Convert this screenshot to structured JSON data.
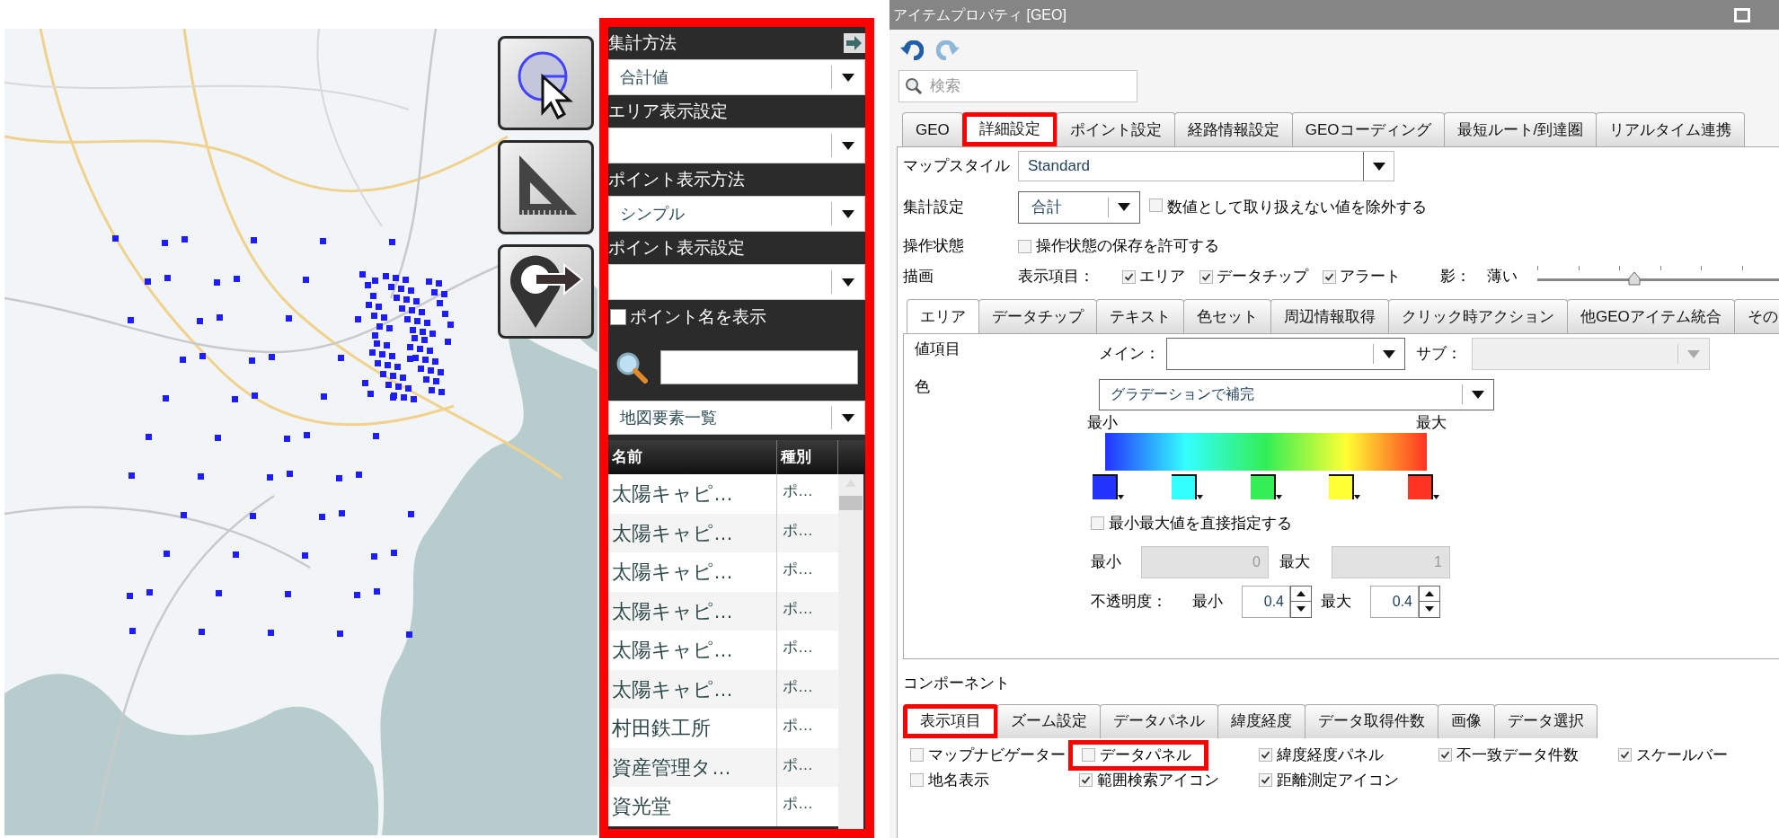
{
  "data_panel": {
    "highlighted": true,
    "fields": [
      {
        "kind": "dropdown",
        "label": "集計方法",
        "value": "合計値"
      },
      {
        "kind": "dropdown",
        "label": "エリア表示設定"
      },
      {
        "kind": "dropdown",
        "label": "ポイント表示方法",
        "value": "シンプル"
      },
      {
        "kind": "dropdown",
        "label": "ポイント表示設定"
      },
      {
        "kind": "checkbox",
        "label": "ポイント名を表示",
        "checked": false
      }
    ],
    "list_select": {
      "value": "地図要素一覧"
    },
    "table": {
      "columns": [
        "名前",
        "種別"
      ],
      "rows": [
        {
          "name": "太陽キャピ…",
          "type": "ポ…"
        },
        {
          "name": "太陽キャピ…",
          "type": "ポ…"
        },
        {
          "name": "太陽キャピ…",
          "type": "ポ…"
        },
        {
          "name": "太陽キャピ…",
          "type": "ポ…"
        },
        {
          "name": "太陽キャピ…",
          "type": "ポ…"
        },
        {
          "name": "太陽キャピ…",
          "type": "ポ…"
        },
        {
          "name": "村田鉄工所",
          "type": "ポ…"
        },
        {
          "name": "資産管理タ…",
          "type": "ポ…"
        },
        {
          "name": "資光堂",
          "type": "ポ…"
        }
      ]
    }
  },
  "window": {
    "title": "アイテムプロパティ [GEO]",
    "search": {
      "placeholder": "検索"
    },
    "tabs": [
      {
        "label": "GEO",
        "selected": false,
        "highlighted": false
      },
      {
        "label": "詳細設定",
        "selected": true,
        "highlighted": true
      },
      {
        "label": "ポイント設定",
        "selected": false,
        "highlighted": false
      },
      {
        "label": "経路情報設定",
        "selected": false,
        "highlighted": false
      },
      {
        "label": "GEOコーディング",
        "selected": false,
        "highlighted": false
      },
      {
        "label": "最短ルート/到達圏",
        "selected": false,
        "highlighted": false
      },
      {
        "label": "リアルタイム連携",
        "selected": false,
        "highlighted": false
      }
    ],
    "settings": {
      "map_style": {
        "label": "マップスタイル",
        "value": "Standard"
      },
      "aggregation": {
        "label": "集計設定",
        "value": "合計",
        "option": {
          "label": "数値として取り扱えない値を除外する",
          "checked": false
        }
      },
      "operation": {
        "label": "操作状態",
        "option": {
          "label": "操作状態の保存を許可する",
          "checked": false
        }
      },
      "drawing": {
        "label": "描画",
        "items_label": "表示項目：",
        "items": [
          {
            "label": "エリア",
            "checked": true
          },
          {
            "label": "データチップ",
            "checked": true
          },
          {
            "label": "アラート",
            "checked": true
          }
        ],
        "shadow_label": "影：",
        "shadow_value": "薄い",
        "shadow_level": {
          "level": 0.4
        }
      }
    },
    "sub_tabs": [
      {
        "label": "エリア",
        "selected": true
      },
      {
        "label": "データチップ",
        "selected": false
      },
      {
        "label": "テキスト",
        "selected": false
      },
      {
        "label": "色セット",
        "selected": false
      },
      {
        "label": "周辺情報取得",
        "selected": false
      },
      {
        "label": "クリック時アクション",
        "selected": false
      },
      {
        "label": "他GEOアイテム統合",
        "selected": false
      },
      {
        "label": "その",
        "selected": false
      }
    ],
    "area": {
      "value_item_label": "値項目",
      "main_label": "メイン：",
      "sub_label": "サブ：",
      "sub_disabled": true,
      "color_label": "色",
      "color_mode": "グラデーションで補完",
      "gradient_min": "最小",
      "gradient_max": "最大",
      "stops": [
        {
          "color": "#2233ff"
        },
        {
          "color": "#33ffff"
        },
        {
          "color": "#33ee55"
        },
        {
          "color": "#ffff33"
        },
        {
          "color": "#ff3322"
        }
      ],
      "direct": {
        "label": "最小最大値を直接指定する",
        "checked": false
      },
      "min_label": "最小",
      "min_value": "0",
      "max_label": "最大",
      "max_value": "1",
      "range_disabled": true,
      "opacity_label": "不透明度：",
      "opacity_min_label": "最小",
      "opacity_min": "0.4",
      "opacity_max_label": "最大",
      "opacity_max": "0.4"
    },
    "components": {
      "label": "コンポーネント",
      "tabs": [
        {
          "label": "表示項目",
          "selected": true,
          "highlighted": true
        },
        {
          "label": "ズーム設定",
          "selected": false,
          "highlighted": false
        },
        {
          "label": "データパネル",
          "selected": false,
          "highlighted": false
        },
        {
          "label": "緯度経度",
          "selected": false,
          "highlighted": false
        },
        {
          "label": "データ取得件数",
          "selected": false,
          "highlighted": false
        },
        {
          "label": "画像",
          "selected": false,
          "highlighted": false
        },
        {
          "label": "データ選択",
          "selected": false,
          "highlighted": false
        }
      ],
      "options": [
        {
          "label": "マップナビゲーター",
          "checked": false,
          "highlighted": false
        },
        {
          "label": "データパネル",
          "checked": false,
          "highlighted": true
        },
        {
          "label": "緯度経度パネル",
          "checked": true,
          "highlighted": false
        },
        {
          "label": "不一致データ件数",
          "checked": true,
          "highlighted": false
        },
        {
          "label": "スケールバー",
          "checked": true,
          "highlighted": false
        },
        {
          "label": "地名表示",
          "checked": false,
          "highlighted": false
        },
        {
          "label": "範囲検索アイコン",
          "checked": true,
          "highlighted": false
        },
        {
          "label": "距離測定アイコン",
          "checked": true,
          "highlighted": false
        }
      ]
    }
  }
}
